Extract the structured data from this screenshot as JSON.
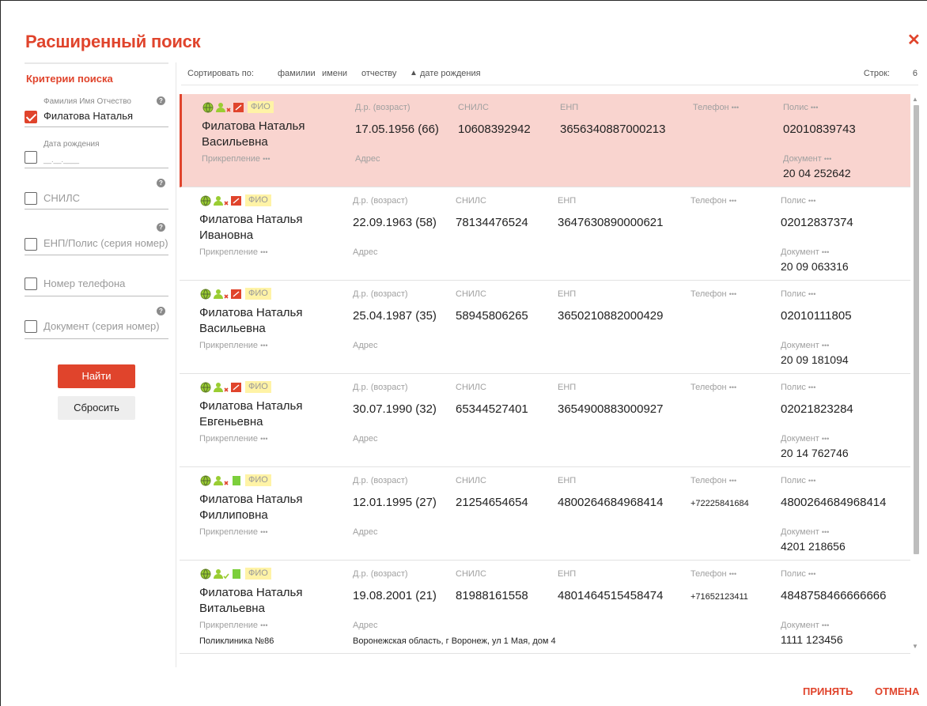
{
  "dialog": {
    "title": "Расширенный поиск",
    "close_icon": "close-icon",
    "accept_label": "ПРИНЯТЬ",
    "cancel_label": "ОТМЕНА"
  },
  "criteria": {
    "title": "Критерии поиска",
    "fields": [
      {
        "label": "Фамилия Имя Отчество",
        "value": "Филатова Наталья",
        "checked": true,
        "help": "?"
      },
      {
        "label": "Дата рождения",
        "value": "__.__.____",
        "checked": false
      },
      {
        "label": "СНИЛС",
        "checked": false,
        "help": "?"
      },
      {
        "label": "ЕНП/Полис (серия номер)",
        "checked": false,
        "help": "?"
      },
      {
        "label": "Номер телефона",
        "checked": false
      },
      {
        "label": "Документ (серия номер)",
        "checked": false,
        "help": "?"
      }
    ],
    "find_label": "Найти",
    "reset_label": "Сбросить"
  },
  "sort": {
    "label": "Сортировать по:",
    "options": [
      "фамилии",
      "имени",
      "отчеству",
      "дате рождения"
    ],
    "active": "дате рождения",
    "arrow": "▲",
    "rows_label": "Строк:",
    "rows_count": "6"
  },
  "labels": {
    "dob": "Д.р. (возраст)",
    "snils": "СНИЛС",
    "enp": "ЕНП",
    "phone": "Телефон",
    "policy": "Полис",
    "attach": "Прикрепление",
    "address": "Адрес",
    "document": "Документ",
    "dots": "•••",
    "fio": "ФИО"
  },
  "records": [
    {
      "name": "Филатова Наталья Васильевна",
      "dob": "17.05.1956 (66)",
      "snils": "10608392942",
      "enp": "3656340887000213",
      "phone": "",
      "policy": "02010839743",
      "document": "20 04 252642",
      "attach": "",
      "address": "",
      "selected": true,
      "status_icon": "red-card-icon",
      "person_icon": "person-x-icon"
    },
    {
      "name": "Филатова Наталья Ивановна",
      "dob": "22.09.1963 (58)",
      "snils": "78134476524",
      "enp": "3647630890000621",
      "phone": "",
      "policy": "02012837374",
      "document": "20 09 063316",
      "attach": "",
      "address": "",
      "selected": false,
      "status_icon": "red-card-icon",
      "person_icon": "person-x-icon"
    },
    {
      "name": "Филатова Наталья Васильевна",
      "dob": "25.04.1987 (35)",
      "snils": "58945806265",
      "enp": "3650210882000429",
      "phone": "",
      "policy": "02010111805",
      "document": "20 09 181094",
      "attach": "",
      "address": "",
      "selected": false,
      "status_icon": "red-card-icon",
      "person_icon": "person-x-icon"
    },
    {
      "name": "Филатова Наталья Евгеньевна",
      "dob": "30.07.1990 (32)",
      "snils": "65344527401",
      "enp": "3654900883000927",
      "phone": "",
      "policy": "02021823284",
      "document": "20 14 762746",
      "attach": "",
      "address": "",
      "selected": false,
      "status_icon": "red-card-icon",
      "person_icon": "person-x-icon"
    },
    {
      "name": "Филатова Наталья Филлиповна",
      "dob": "12.01.1995 (27)",
      "snils": "21254654654",
      "enp": "4800264684968414",
      "phone": "+72225841684",
      "policy": "4800264684968414",
      "document": "4201 218656",
      "attach": "",
      "address": "",
      "selected": false,
      "status_icon": "green-card-icon",
      "person_icon": "person-x-icon"
    },
    {
      "name": "Филатова Наталья Витальевна",
      "dob": "19.08.2001 (21)",
      "snils": "81988161558",
      "enp": "4801464515458474",
      "phone": "+71652123411",
      "policy": "4848758466666666",
      "document": "1111 123456",
      "attach": "Поликлиника №86",
      "address": "Воронежская область, г Воронеж, ул 1 Мая, дом 4",
      "selected": false,
      "status_icon": "green-card-icon",
      "person_icon": "person-check-icon"
    }
  ],
  "colors": {
    "accent": "#e0442c",
    "selected_row": "#f9d4cf",
    "badge": "#fff3a6"
  }
}
